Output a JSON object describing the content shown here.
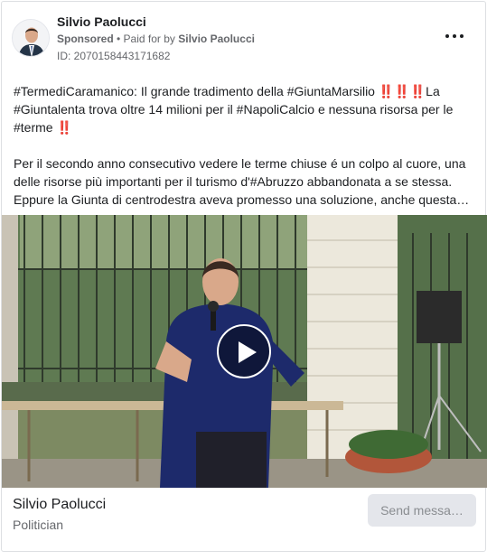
{
  "post": {
    "page_name": "Silvio Paolucci",
    "sponsored_label": "Sponsored",
    "paid_for_prefix": " • Paid for by ",
    "payer": "Silvio Paolucci",
    "ad_id": "ID: 2070158443171682",
    "paragraph_1": "#TermediCaramanico: Il grande tradimento della #GiuntaMarsilio ‼️‼️‼️La #Giuntalenta trova oltre 14 milioni per il #NapoliCalcio e nessuna risorsa per le #terme ‼️",
    "paragraph_2_line_1": "Per il secondo anno consecutivo vedere le terme chiuse é un colpo al cuore, una",
    "paragraph_2_line_2": "delle risorse più importanti per il turismo d'#Abruzzo abbandonata a se stessa.",
    "paragraph_2_line_3": "Eppure la Giunta di centrodestra aveva promesso una soluzione, anche questa…"
  },
  "footer": {
    "name": "Silvio Paolucci",
    "role": "Politician",
    "cta_label": "Send messa…"
  },
  "video": {
    "pillar_number": "16"
  },
  "icons": {
    "more": "more-horizontal-icon",
    "play": "play-icon"
  },
  "colors": {
    "text": "#1c1e21",
    "secondary_text": "#65676b",
    "button_bg": "#e4e6eb"
  }
}
